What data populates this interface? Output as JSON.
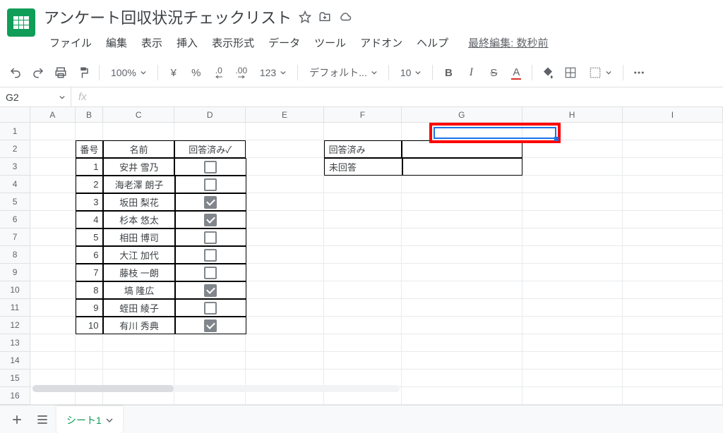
{
  "doc": {
    "title": "アンケート回収状況チェックリスト",
    "last_edit": "最終編集: 数秒前"
  },
  "menu": [
    "ファイル",
    "編集",
    "表示",
    "挿入",
    "表示形式",
    "データ",
    "ツール",
    "アドオン",
    "ヘルプ"
  ],
  "toolbar": {
    "zoom": "100%",
    "currency": "¥",
    "percent": "%",
    "dec_dec": ".0",
    "dec_inc": ".00",
    "formats": "123",
    "font": "デフォルト...",
    "font_size": "10"
  },
  "name_box": "G2",
  "formula": "",
  "columns": [
    "A",
    "B",
    "C",
    "D",
    "E",
    "F",
    "G",
    "H",
    "I"
  ],
  "rows": [
    "1",
    "2",
    "3",
    "4",
    "5",
    "6",
    "7",
    "8",
    "9",
    "10",
    "11",
    "12",
    "13",
    "14",
    "15",
    "16"
  ],
  "table_head": {
    "no": "番号",
    "name": "名前",
    "done": "回答済み✓"
  },
  "table": [
    {
      "no": "1",
      "name": "安井 雪乃",
      "done": false
    },
    {
      "no": "2",
      "name": "海老澤 朗子",
      "done": false
    },
    {
      "no": "3",
      "name": "坂田 梨花",
      "done": true
    },
    {
      "no": "4",
      "name": "杉本 悠太",
      "done": true
    },
    {
      "no": "5",
      "name": "相田 博司",
      "done": false
    },
    {
      "no": "6",
      "name": "大江 加代",
      "done": false
    },
    {
      "no": "7",
      "name": "藤枝 一朗",
      "done": false
    },
    {
      "no": "8",
      "name": "塙 隆広",
      "done": true
    },
    {
      "no": "9",
      "name": "蛭田 綾子",
      "done": false
    },
    {
      "no": "10",
      "name": "有川 秀典",
      "done": true
    }
  ],
  "summary": {
    "answered": "回答済み",
    "unanswered": "未回答"
  },
  "sheet_tab": "シート1"
}
